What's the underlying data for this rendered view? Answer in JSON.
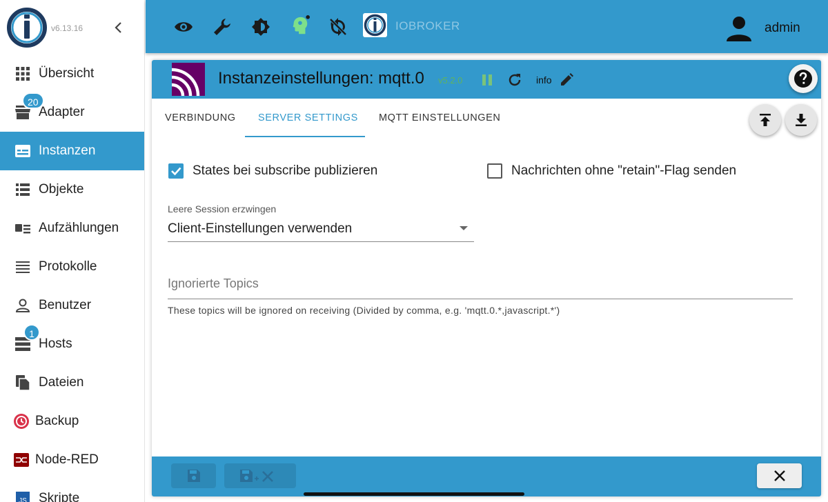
{
  "app": {
    "version": "v6.13.16",
    "brand": "IOBROKER",
    "user": "admin",
    "accent": "#3399cc"
  },
  "sidebar": {
    "items": [
      {
        "label": "Übersicht",
        "icon": "apps-grid-icon"
      },
      {
        "label": "Adapter",
        "icon": "store-icon",
        "badge": "20"
      },
      {
        "label": "Instanzen",
        "icon": "instances-icon",
        "active": true
      },
      {
        "label": "Objekte",
        "icon": "list-icon"
      },
      {
        "label": "Aufzählungen",
        "icon": "enum-icon"
      },
      {
        "label": "Protokolle",
        "icon": "log-lines-icon"
      },
      {
        "label": "Benutzer",
        "icon": "user-outline-icon"
      },
      {
        "label": "Hosts",
        "icon": "hosts-icon",
        "badge": "1"
      },
      {
        "label": "Dateien",
        "icon": "files-icon"
      },
      {
        "label": "Backup",
        "icon": "backup-icon"
      },
      {
        "label": "Node-RED",
        "icon": "node-red-icon"
      },
      {
        "label": "Skripte",
        "icon": "js-icon"
      }
    ]
  },
  "topbar": {
    "icons": [
      "eye-icon",
      "wrench-icon",
      "brightness-icon",
      "expert-mode-icon",
      "sync-disabled-icon"
    ]
  },
  "dialog": {
    "title": "Instanzeinstellungen: mqtt.0",
    "version": "v5.2.0",
    "info_label": "info",
    "tabs": [
      "VERBINDUNG",
      "SERVER SETTINGS",
      "MQTT EINSTELLUNGEN"
    ],
    "active_tab": "SERVER SETTINGS",
    "checkbox_publish": {
      "label": "States bei subscribe publizieren",
      "checked": true
    },
    "checkbox_retain": {
      "label": "Nachrichten ohne \"retain\"-Flag senden",
      "checked": false
    },
    "select_session": {
      "label": "Leere Session erzwingen",
      "value": "Client-Einstellungen verwenden"
    },
    "topics": {
      "placeholder": "Ignorierte Topics",
      "value": "",
      "help": "These topics will be ignored on receiving (Divided by comma, e.g. 'mqtt.0.*,javascript.*')"
    }
  }
}
